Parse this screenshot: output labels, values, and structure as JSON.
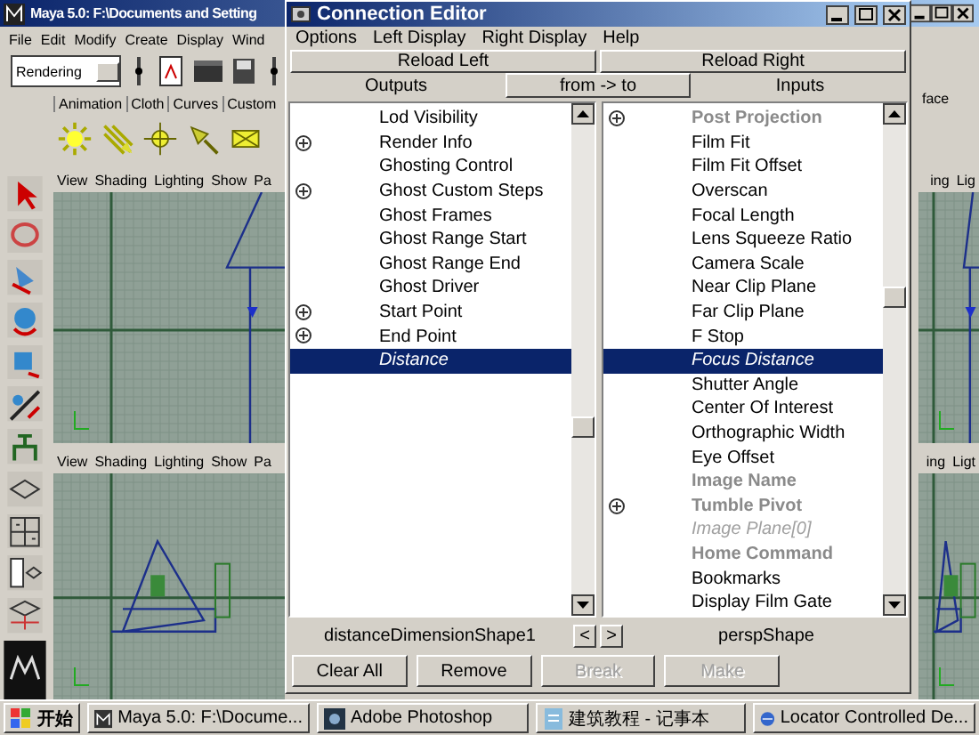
{
  "maya_window": {
    "title": "Maya 5.0: F:\\Documents and Setting",
    "menu": [
      "File",
      "Edit",
      "Modify",
      "Create",
      "Display",
      "Wind"
    ],
    "menu_set": "Rendering",
    "shelf_tabs": [
      "Animation",
      "Cloth",
      "Curves",
      "Custom"
    ],
    "shelf_side_label": "face",
    "viewports": [
      {
        "menu": [
          "View",
          "Shading",
          "Lighting",
          "Show",
          "Pa"
        ]
      },
      {
        "menu": [
          "ing",
          "Lig"
        ]
      },
      {
        "menu": [
          "View",
          "Shading",
          "Lighting",
          "Show",
          "Pa"
        ]
      },
      {
        "menu": [
          "ing",
          "Ligt"
        ]
      }
    ]
  },
  "editor": {
    "title": "Connection Editor",
    "menu": [
      "Options",
      "Left Display",
      "Right Display",
      "Help"
    ],
    "reload_left": "Reload Left",
    "reload_right": "Reload Right",
    "outputs_label": "Outputs",
    "direction_button": "from -> to",
    "inputs_label": "Inputs",
    "left_list": [
      {
        "label": "Lod Visibility",
        "kind": "plain",
        "expandable": false,
        "selected": false
      },
      {
        "label": "Render Info",
        "kind": "plain",
        "expandable": true,
        "selected": false
      },
      {
        "label": "Ghosting Control",
        "kind": "plain",
        "expandable": false,
        "selected": false
      },
      {
        "label": "Ghost Custom Steps",
        "kind": "plain",
        "expandable": true,
        "selected": false
      },
      {
        "label": "Ghost Frames",
        "kind": "plain",
        "expandable": false,
        "selected": false
      },
      {
        "label": "Ghost Range Start",
        "kind": "plain",
        "expandable": false,
        "selected": false
      },
      {
        "label": "Ghost Range End",
        "kind": "plain",
        "expandable": false,
        "selected": false
      },
      {
        "label": "Ghost Driver",
        "kind": "plain",
        "expandable": false,
        "selected": false
      },
      {
        "label": "Start Point",
        "kind": "plain",
        "expandable": true,
        "selected": false
      },
      {
        "label": "End Point",
        "kind": "plain",
        "expandable": true,
        "selected": false
      },
      {
        "label": "Distance",
        "kind": "plain",
        "expandable": false,
        "selected": true
      }
    ],
    "right_list": [
      {
        "label": "Post Projection",
        "kind": "locked",
        "expandable": true,
        "selected": false
      },
      {
        "label": "Film Fit",
        "kind": "plain",
        "expandable": false,
        "selected": false
      },
      {
        "label": "Film Fit Offset",
        "kind": "plain",
        "expandable": false,
        "selected": false
      },
      {
        "label": "Overscan",
        "kind": "plain",
        "expandable": false,
        "selected": false
      },
      {
        "label": "Focal Length",
        "kind": "plain",
        "expandable": false,
        "selected": false
      },
      {
        "label": "Lens Squeeze Ratio",
        "kind": "plain",
        "expandable": false,
        "selected": false
      },
      {
        "label": "Camera Scale",
        "kind": "plain",
        "expandable": false,
        "selected": false
      },
      {
        "label": "Near Clip Plane",
        "kind": "plain",
        "expandable": false,
        "selected": false
      },
      {
        "label": "Far Clip Plane",
        "kind": "plain",
        "expandable": false,
        "selected": false
      },
      {
        "label": "F Stop",
        "kind": "plain",
        "expandable": false,
        "selected": false
      },
      {
        "label": "Focus Distance",
        "kind": "plain",
        "expandable": false,
        "selected": true
      },
      {
        "label": "Shutter Angle",
        "kind": "plain",
        "expandable": false,
        "selected": false
      },
      {
        "label": "Center Of Interest",
        "kind": "plain",
        "expandable": false,
        "selected": false
      },
      {
        "label": "Orthographic Width",
        "kind": "plain",
        "expandable": false,
        "selected": false
      },
      {
        "label": "Eye Offset",
        "kind": "plain",
        "expandable": false,
        "selected": false
      },
      {
        "label": "Image Name",
        "kind": "locked",
        "expandable": false,
        "selected": false
      },
      {
        "label": "Tumble Pivot",
        "kind": "locked",
        "expandable": true,
        "selected": false
      },
      {
        "label": "Image Plane[0]",
        "kind": "faded",
        "expandable": false,
        "selected": false
      },
      {
        "label": "Home Command",
        "kind": "locked",
        "expandable": false,
        "selected": false
      },
      {
        "label": "Bookmarks",
        "kind": "plain",
        "expandable": false,
        "selected": false
      },
      {
        "label": "Display Film Gate",
        "kind": "plain",
        "expandable": false,
        "selected": false
      }
    ],
    "left_node": "distanceDimensionShape1",
    "prev_button": "<",
    "next_button": ">",
    "right_node": "perspShape",
    "buttons": [
      {
        "label": "Clear All",
        "disabled": false
      },
      {
        "label": "Remove",
        "disabled": false
      },
      {
        "label": "Break",
        "disabled": true
      },
      {
        "label": "Make",
        "disabled": true
      }
    ]
  },
  "taskbar": {
    "start": "开始",
    "tasks": [
      {
        "label": "Maya 5.0: F:\\Docume...",
        "kind": "maya"
      },
      {
        "label": "Adobe Photoshop",
        "kind": "photoshop"
      },
      {
        "label": "建筑教程 - 记事本",
        "kind": "notepad"
      },
      {
        "label": "Locator Controlled De...",
        "kind": "browser"
      }
    ]
  }
}
